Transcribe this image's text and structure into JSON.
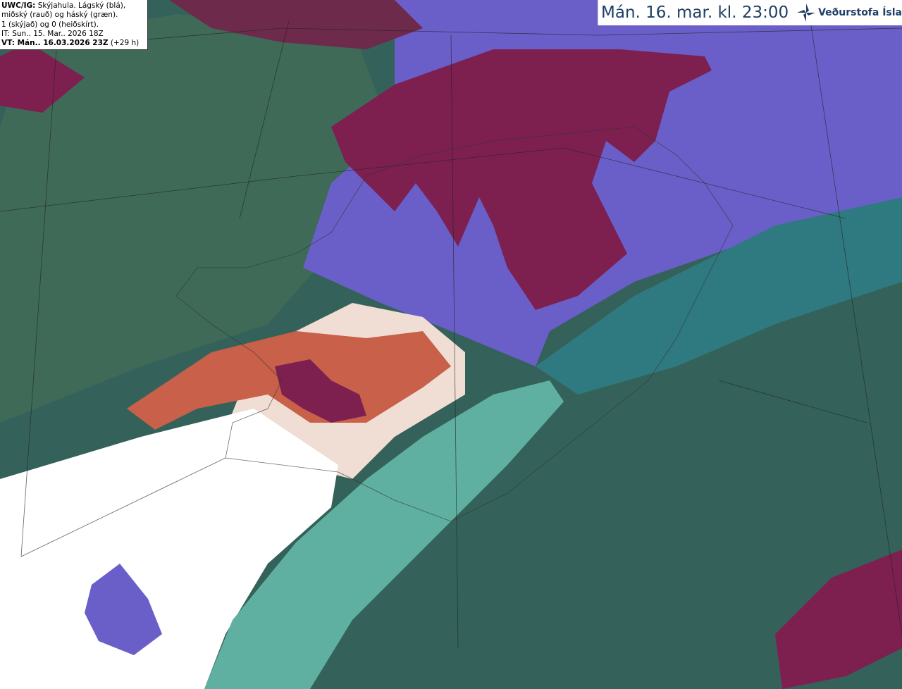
{
  "legend": {
    "product": "UWC/IG:",
    "description_line1": "Skýjahula. Lágský (blá),",
    "description_line2": "miðský (rauð) og háský (græn).",
    "description_line3": "1 (skýjað) og 0 (heiðskírt).",
    "init_time": "IT: Sun.. 15. Mar.. 2026 18Z",
    "valid_time_label": "VT: Mán.. 16.03.2026 23Z",
    "lead_time": "(+29 h)"
  },
  "header": {
    "title": "Mán. 16. mar. kl. 23:00",
    "logo_text": "Veðurstofa Íslands",
    "logo_icon": "vedurstofa-star-icon"
  },
  "colors": {
    "low_cloud": "#6a5fc8",
    "mid_cloud": "#7d2050",
    "high_cloud": "#1fd6a0",
    "clear": "#ffffff",
    "brand": "#1f3f66"
  }
}
